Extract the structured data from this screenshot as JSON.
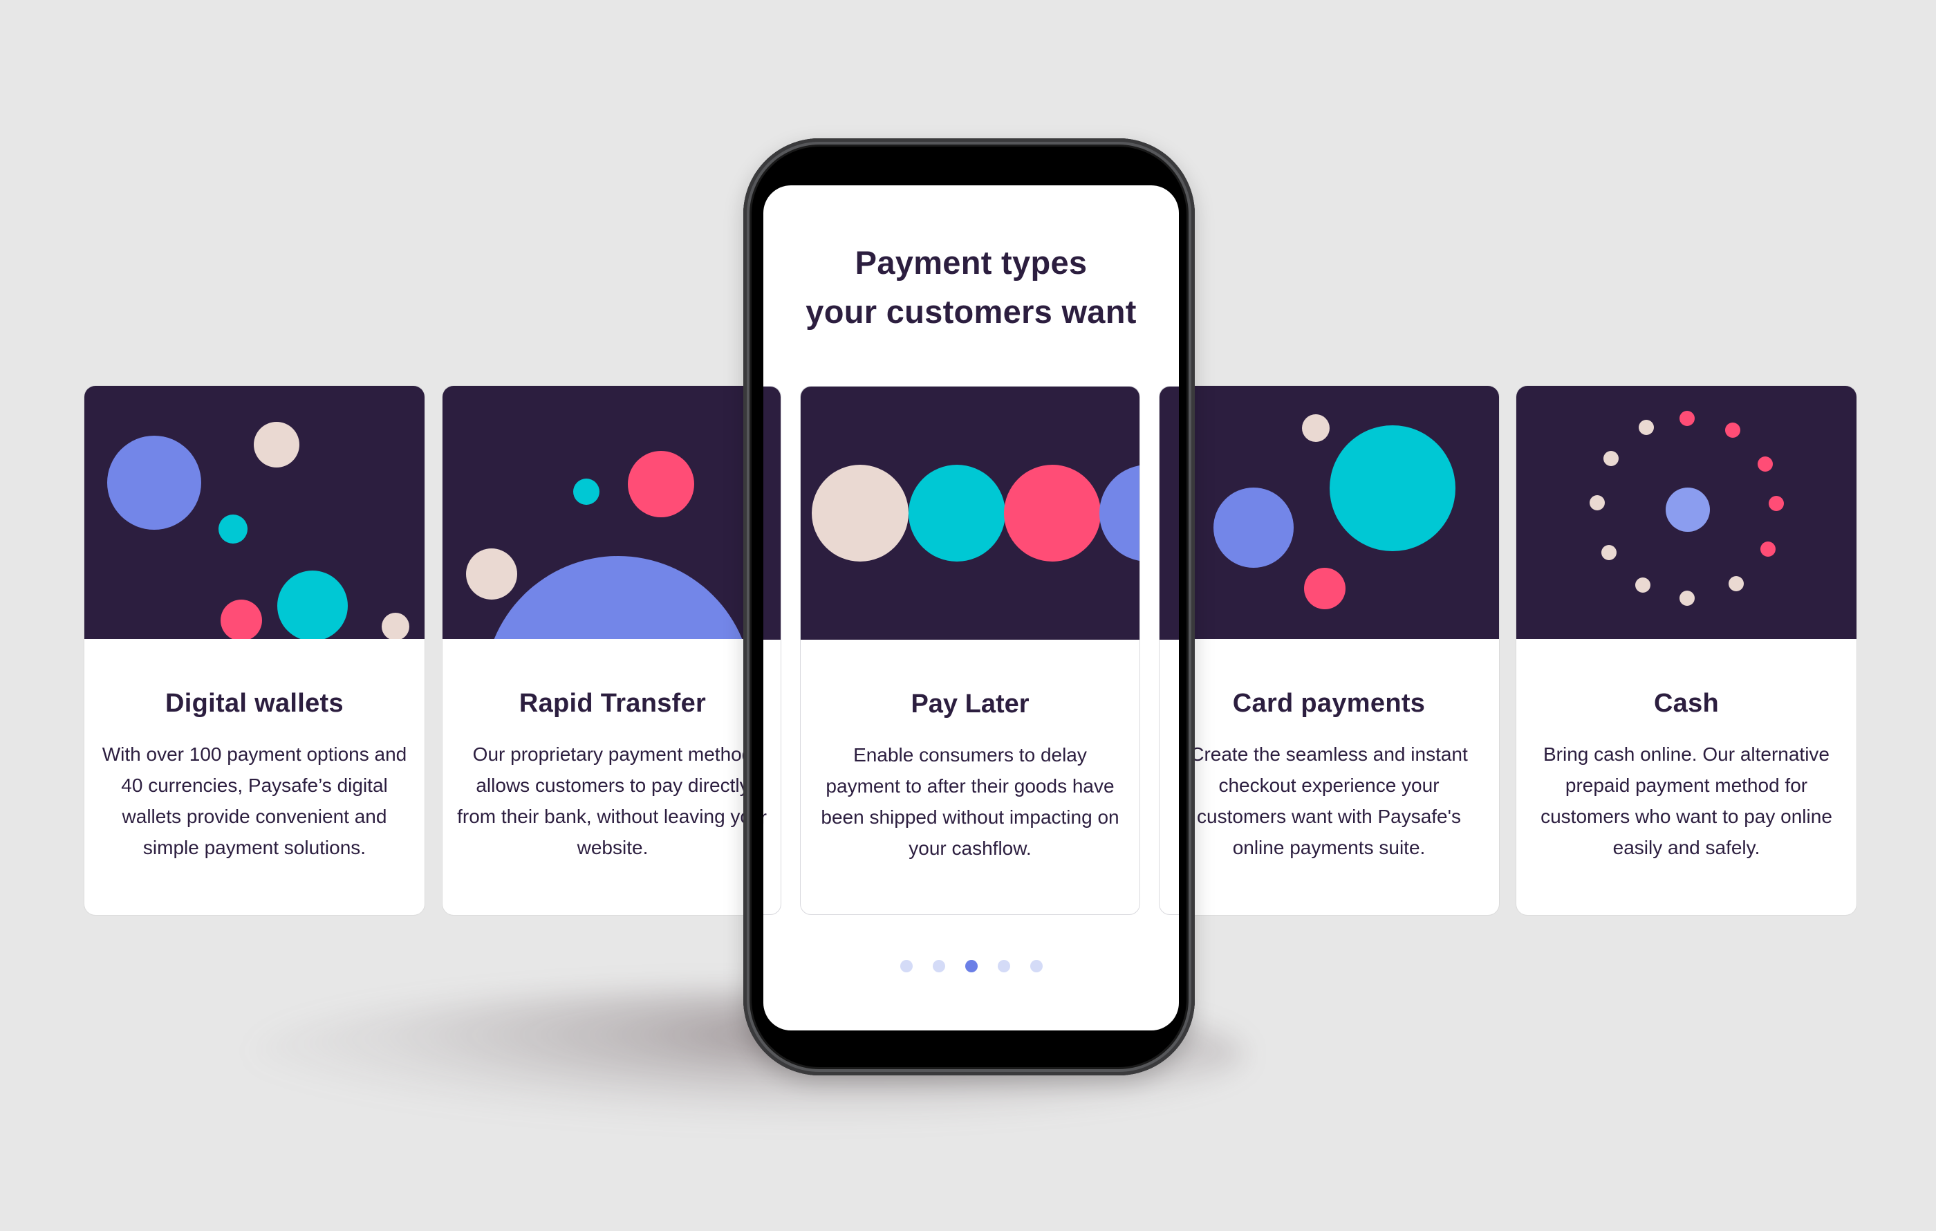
{
  "headline": {
    "line1": "Payment types",
    "line2": "your customers want"
  },
  "colors": {
    "navy": "#2c1e3f",
    "periwinkle": "#7386e8",
    "cyan": "#00c8d4",
    "pink": "#ff4d76",
    "beige": "#ead9d2",
    "dot_inactive": "#d4dbf7",
    "dot_active": "#6b7fe6"
  },
  "cards": [
    {
      "title": "Digital wallets",
      "description": "With over 100 payment options and 40 currencies, Paysafe’s digital wallets provide convenient and simple payment solutions.",
      "illustration": "scattered-bubbles"
    },
    {
      "title": "Rapid Transfer",
      "description": "Our proprietary payment method allows customers to pay directly from their bank, without leaving your website.",
      "illustration": "rising-semicircle"
    },
    {
      "title": "Pay Later",
      "description": "Enable consumers to delay payment to after their goods have been shipped without impacting on your cashflow.",
      "illustration": "row-of-circles"
    },
    {
      "title": "Card payments",
      "description": "Create the seamless and instant checkout experience your customers want with Paysafe's online payments suite.",
      "illustration": "cluster-of-circles"
    },
    {
      "title": "Cash",
      "description": "Bring cash online. Our alternative prepaid payment method for customers who want to pay online easily and safely.",
      "illustration": "ring-of-dots"
    }
  ],
  "pagination": {
    "total": 5,
    "active_index": 2
  }
}
